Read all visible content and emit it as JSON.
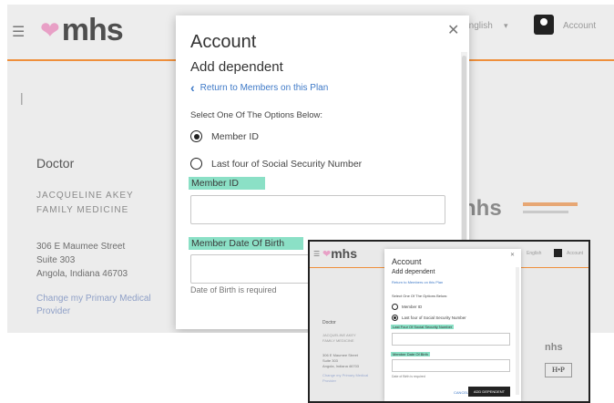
{
  "header": {
    "logo_text": "mhs",
    "language": "English",
    "account_label": "Account"
  },
  "background_page": {
    "section_title": "Doctor",
    "provider_name_line1": "JACQUELINE AKEY",
    "provider_name_line2": "FAMILY MEDICINE",
    "address_line1": "306 E Maumee Street",
    "address_line2": "Suite 303",
    "address_line3": "Angola, Indiana 46703",
    "change_link_line1": "Change my Primary Medical",
    "change_link_line2": "Provider",
    "side_brand": "nhs"
  },
  "modal": {
    "title": "Account",
    "subtitle": "Add dependent",
    "back_link": "Return to Members on this Plan",
    "select_prompt": "Select One Of The Options Below:",
    "options": [
      {
        "label": "Member ID",
        "selected": true
      },
      {
        "label": "Last four of Social Security Number",
        "selected": false
      }
    ],
    "field1_label": "Member ID",
    "field2_label": "Member Date Of Birth",
    "dob_hint": "Date of Birth is required",
    "highlight_color": "#8be0c6"
  },
  "inset": {
    "logo_text": "mhs",
    "title": "Account",
    "subtitle": "Add dependent",
    "back_link": "Return to Members on this Plan",
    "select_prompt": "Select One Of The Options Below:",
    "options": [
      {
        "label": "Member ID",
        "selected": false
      },
      {
        "label": "Last four of Social Security Number",
        "selected": true
      }
    ],
    "field1_label": "Last Four Of Social Security Number",
    "field2_label": "Member Date Of Birth",
    "dob_hint": "Date of Birth is required",
    "cancel": "CANCEL",
    "add_button": "ADD DEPENDENT",
    "side_title": "Doctor",
    "side_name1": "JACQUELINE AKEY",
    "side_name2": "FAMILY MEDICINE",
    "side_addr1": "306 E Maumee Street",
    "side_addr2": "Suite 303",
    "side_addr3": "Angola, Indiana 46703",
    "side_link1": "Change my Primary Medical",
    "side_link2": "Provider",
    "nhs": "nhs",
    "hp": "H•P"
  }
}
